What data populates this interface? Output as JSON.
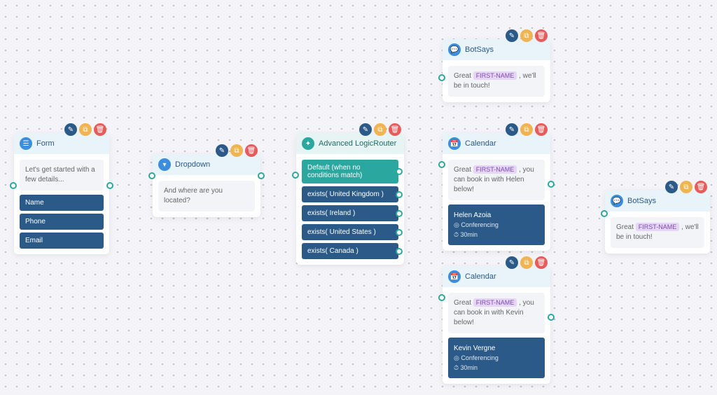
{
  "nodes": {
    "form": {
      "title": "Form",
      "prompt": "Let's get started with a few details...",
      "fields": [
        "Name",
        "Phone",
        "Email"
      ]
    },
    "dropdown": {
      "title": "Dropdown",
      "prompt": "And where are you located?"
    },
    "router": {
      "title": "Advanced LogicRouter",
      "default_label": "Default (when no conditions match)",
      "conditions": [
        "exists( United Kingdom )",
        "exists( Ireland )",
        "exists( United States )",
        "exists( Canada )"
      ]
    },
    "botsays1": {
      "title": "BotSays",
      "text_before": "Great ",
      "tag": "FIRST-NAME",
      "text_after": " , we'll be in touch!"
    },
    "calendar1": {
      "title": "Calendar",
      "text_before": "Great ",
      "tag": "FIRST-NAME",
      "text_after": " , you can book in with Helen below!",
      "person": "Helen Azoia",
      "location": "Conferencing",
      "duration": "30min"
    },
    "calendar2": {
      "title": "Calendar",
      "text_before": "Great ",
      "tag": "FIRST-NAME",
      "text_after": " , you can book in with Kevin below!",
      "person": "Kevin Vergne",
      "location": "Conferencing",
      "duration": "30min"
    },
    "botsays2": {
      "title": "BotSays",
      "text_before": "Great ",
      "tag": "FIRST-NAME",
      "text_after": " , we'll be in touch!"
    }
  },
  "icons": {
    "form": "☰",
    "dropdown": "▾",
    "router": "✦",
    "chat": "💬",
    "calendar": "📅",
    "edit": "✎",
    "copy": "⧉",
    "delete": "🗑",
    "location": "◎",
    "clock": "⏱"
  }
}
